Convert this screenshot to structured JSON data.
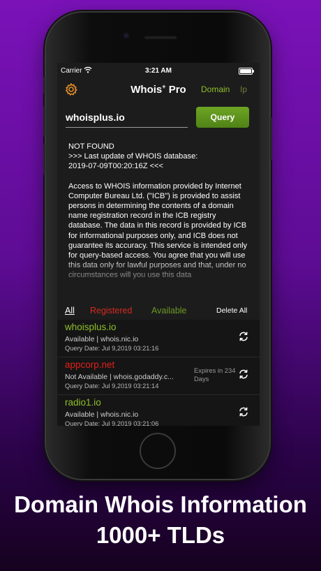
{
  "status_bar": {
    "carrier": "Carrier",
    "time": "3:21 AM"
  },
  "nav": {
    "title": "Whois",
    "title_sup": "+",
    "title_suffix": " Pro",
    "tab_domain": "Domain",
    "tab_ip": "Ip",
    "gear_icon": "gear-icon"
  },
  "query": {
    "input_value": "whoisplus.io",
    "button_label": "Query"
  },
  "result": {
    "paragraph1": "NOT FOUND\n>>> Last update of WHOIS database:\n2019-07-09T00:20:16Z <<<",
    "paragraph2": "Access to WHOIS information provided by Internet Computer Bureau Ltd. (\"ICB\") is provided to assist persons in determining the contents of a domain name registration record in the ICB registry database. The data in this record is provided by ICB for informational purposes only, and ICB does not guarantee its accuracy. This service is intended only for query-based access. You agree that you will use this data only for lawful purposes and that, under no circumstances will you use this data"
  },
  "filters": {
    "all": "All",
    "registered": "Registered",
    "available": "Available",
    "delete_all": "Delete All"
  },
  "domains": [
    {
      "name": "whoisplus.io",
      "status": "available",
      "info": "Available | whois.nic.io",
      "date": "Query Date: Jul 9,2019  03:21:16",
      "expires": ""
    },
    {
      "name": "appcorp.net",
      "status": "registered",
      "info": "Not Available | whois.godaddy.c...",
      "date": "Query Date: Jul 9,2019  03:21:14",
      "expires": "Expires in 234 Days"
    },
    {
      "name": "radio1.io",
      "status": "available",
      "info": "Available | whois.nic.io",
      "date": "Query Date: Jul 9,2019  03:21:06",
      "expires": ""
    }
  ],
  "caption": {
    "line1": "Domain Whois Information",
    "line2": "1000+ TLDs"
  },
  "colors": {
    "accent_green": "#8fbf2a",
    "registered_red": "#e02018",
    "gear_orange": "#e08a2a"
  }
}
